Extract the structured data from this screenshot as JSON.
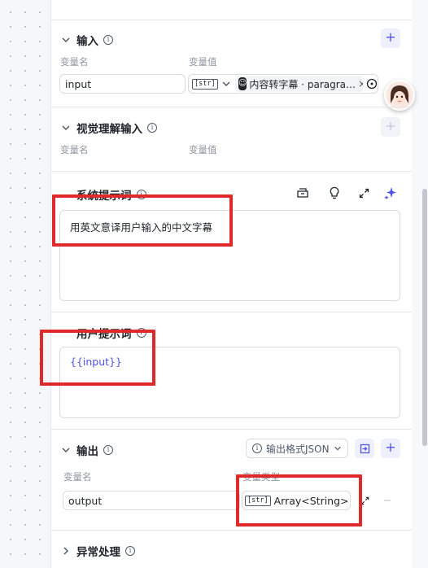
{
  "input_section": {
    "title": "输入",
    "col_name": "变量名",
    "col_value": "变量值",
    "row": {
      "name": "input",
      "type_tag": "[str]",
      "ref_label": "内容转字幕 · paragra…",
      "clear": "×"
    }
  },
  "visual_section": {
    "title": "视觉理解输入",
    "col_name": "变量名",
    "col_value": "变量值"
  },
  "system_prompt": {
    "title": "系统提示词",
    "text": "用英文意译用户输入的中文字幕"
  },
  "user_prompt": {
    "title": "用户提示词",
    "text": "{{input}}"
  },
  "output_section": {
    "title": "输出",
    "format_label": "输出格式JSON",
    "col_name": "变量名",
    "col_type": "变量类型",
    "row": {
      "name": "output",
      "type_tag": "[str]",
      "type_label": "Array<String>"
    }
  },
  "exception_section": {
    "title": "异常处理"
  },
  "colors": {
    "accent": "#4d53e8",
    "highlight": "#e02a2a"
  },
  "icons": [
    "chevron-down-icon",
    "info-icon",
    "plus-icon",
    "minus-icon",
    "library-icon",
    "bulb-icon",
    "expand-icon",
    "sparkle-icon",
    "target-icon",
    "import-icon"
  ]
}
